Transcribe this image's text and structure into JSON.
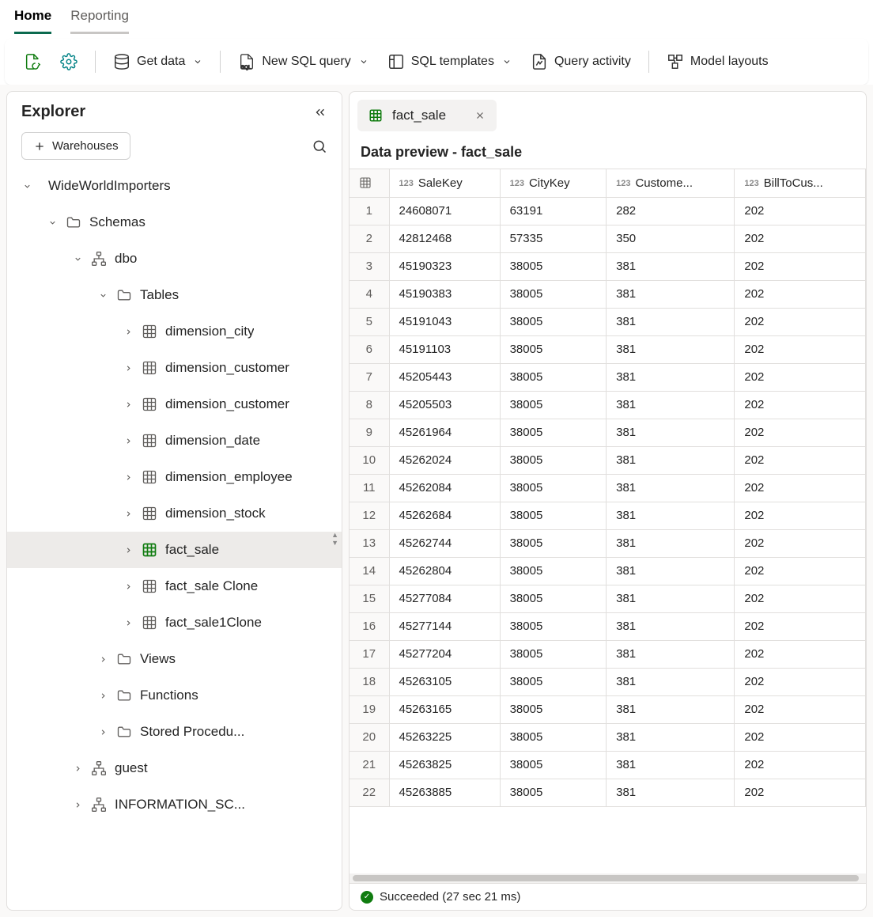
{
  "tabs": {
    "home": "Home",
    "reporting": "Reporting"
  },
  "ribbon": {
    "get_data": "Get data",
    "new_sql": "New SQL query",
    "sql_templates": "SQL templates",
    "query_activity": "Query activity",
    "model_layouts": "Model layouts"
  },
  "explorer": {
    "title": "Explorer",
    "warehouses_btn": "Warehouses",
    "tree": {
      "root": "WideWorldImporters",
      "schemas": "Schemas",
      "dbo": "dbo",
      "tables": "Tables",
      "table_items": [
        "dimension_city",
        "dimension_customer",
        "dimension_customer",
        "dimension_date",
        "dimension_employee",
        "dimension_stock",
        "fact_sale",
        "fact_sale Clone",
        "fact_sale1Clone"
      ],
      "views": "Views",
      "functions": "Functions",
      "stored_procs": "Stored Procedu...",
      "guest": "guest",
      "info_schema": "INFORMATION_SC..."
    }
  },
  "doc_tab": "fact_sale",
  "preview_title": "Data preview - fact_sale",
  "columns": [
    {
      "type": "123",
      "name": "SaleKey"
    },
    {
      "type": "123",
      "name": "CityKey"
    },
    {
      "type": "123",
      "name": "Custome..."
    },
    {
      "type": "123",
      "name": "BillToCus..."
    }
  ],
  "rows": [
    [
      1,
      24608071,
      63191,
      282,
      202
    ],
    [
      2,
      42812468,
      57335,
      350,
      202
    ],
    [
      3,
      45190323,
      38005,
      381,
      202
    ],
    [
      4,
      45190383,
      38005,
      381,
      202
    ],
    [
      5,
      45191043,
      38005,
      381,
      202
    ],
    [
      6,
      45191103,
      38005,
      381,
      202
    ],
    [
      7,
      45205443,
      38005,
      381,
      202
    ],
    [
      8,
      45205503,
      38005,
      381,
      202
    ],
    [
      9,
      45261964,
      38005,
      381,
      202
    ],
    [
      10,
      45262024,
      38005,
      381,
      202
    ],
    [
      11,
      45262084,
      38005,
      381,
      202
    ],
    [
      12,
      45262684,
      38005,
      381,
      202
    ],
    [
      13,
      45262744,
      38005,
      381,
      202
    ],
    [
      14,
      45262804,
      38005,
      381,
      202
    ],
    [
      15,
      45277084,
      38005,
      381,
      202
    ],
    [
      16,
      45277144,
      38005,
      381,
      202
    ],
    [
      17,
      45277204,
      38005,
      381,
      202
    ],
    [
      18,
      45263105,
      38005,
      381,
      202
    ],
    [
      19,
      45263165,
      38005,
      381,
      202
    ],
    [
      20,
      45263225,
      38005,
      381,
      202
    ],
    [
      21,
      45263825,
      38005,
      381,
      202
    ],
    [
      22,
      45263885,
      38005,
      381,
      202
    ]
  ],
  "status": "Succeeded (27 sec 21 ms)"
}
